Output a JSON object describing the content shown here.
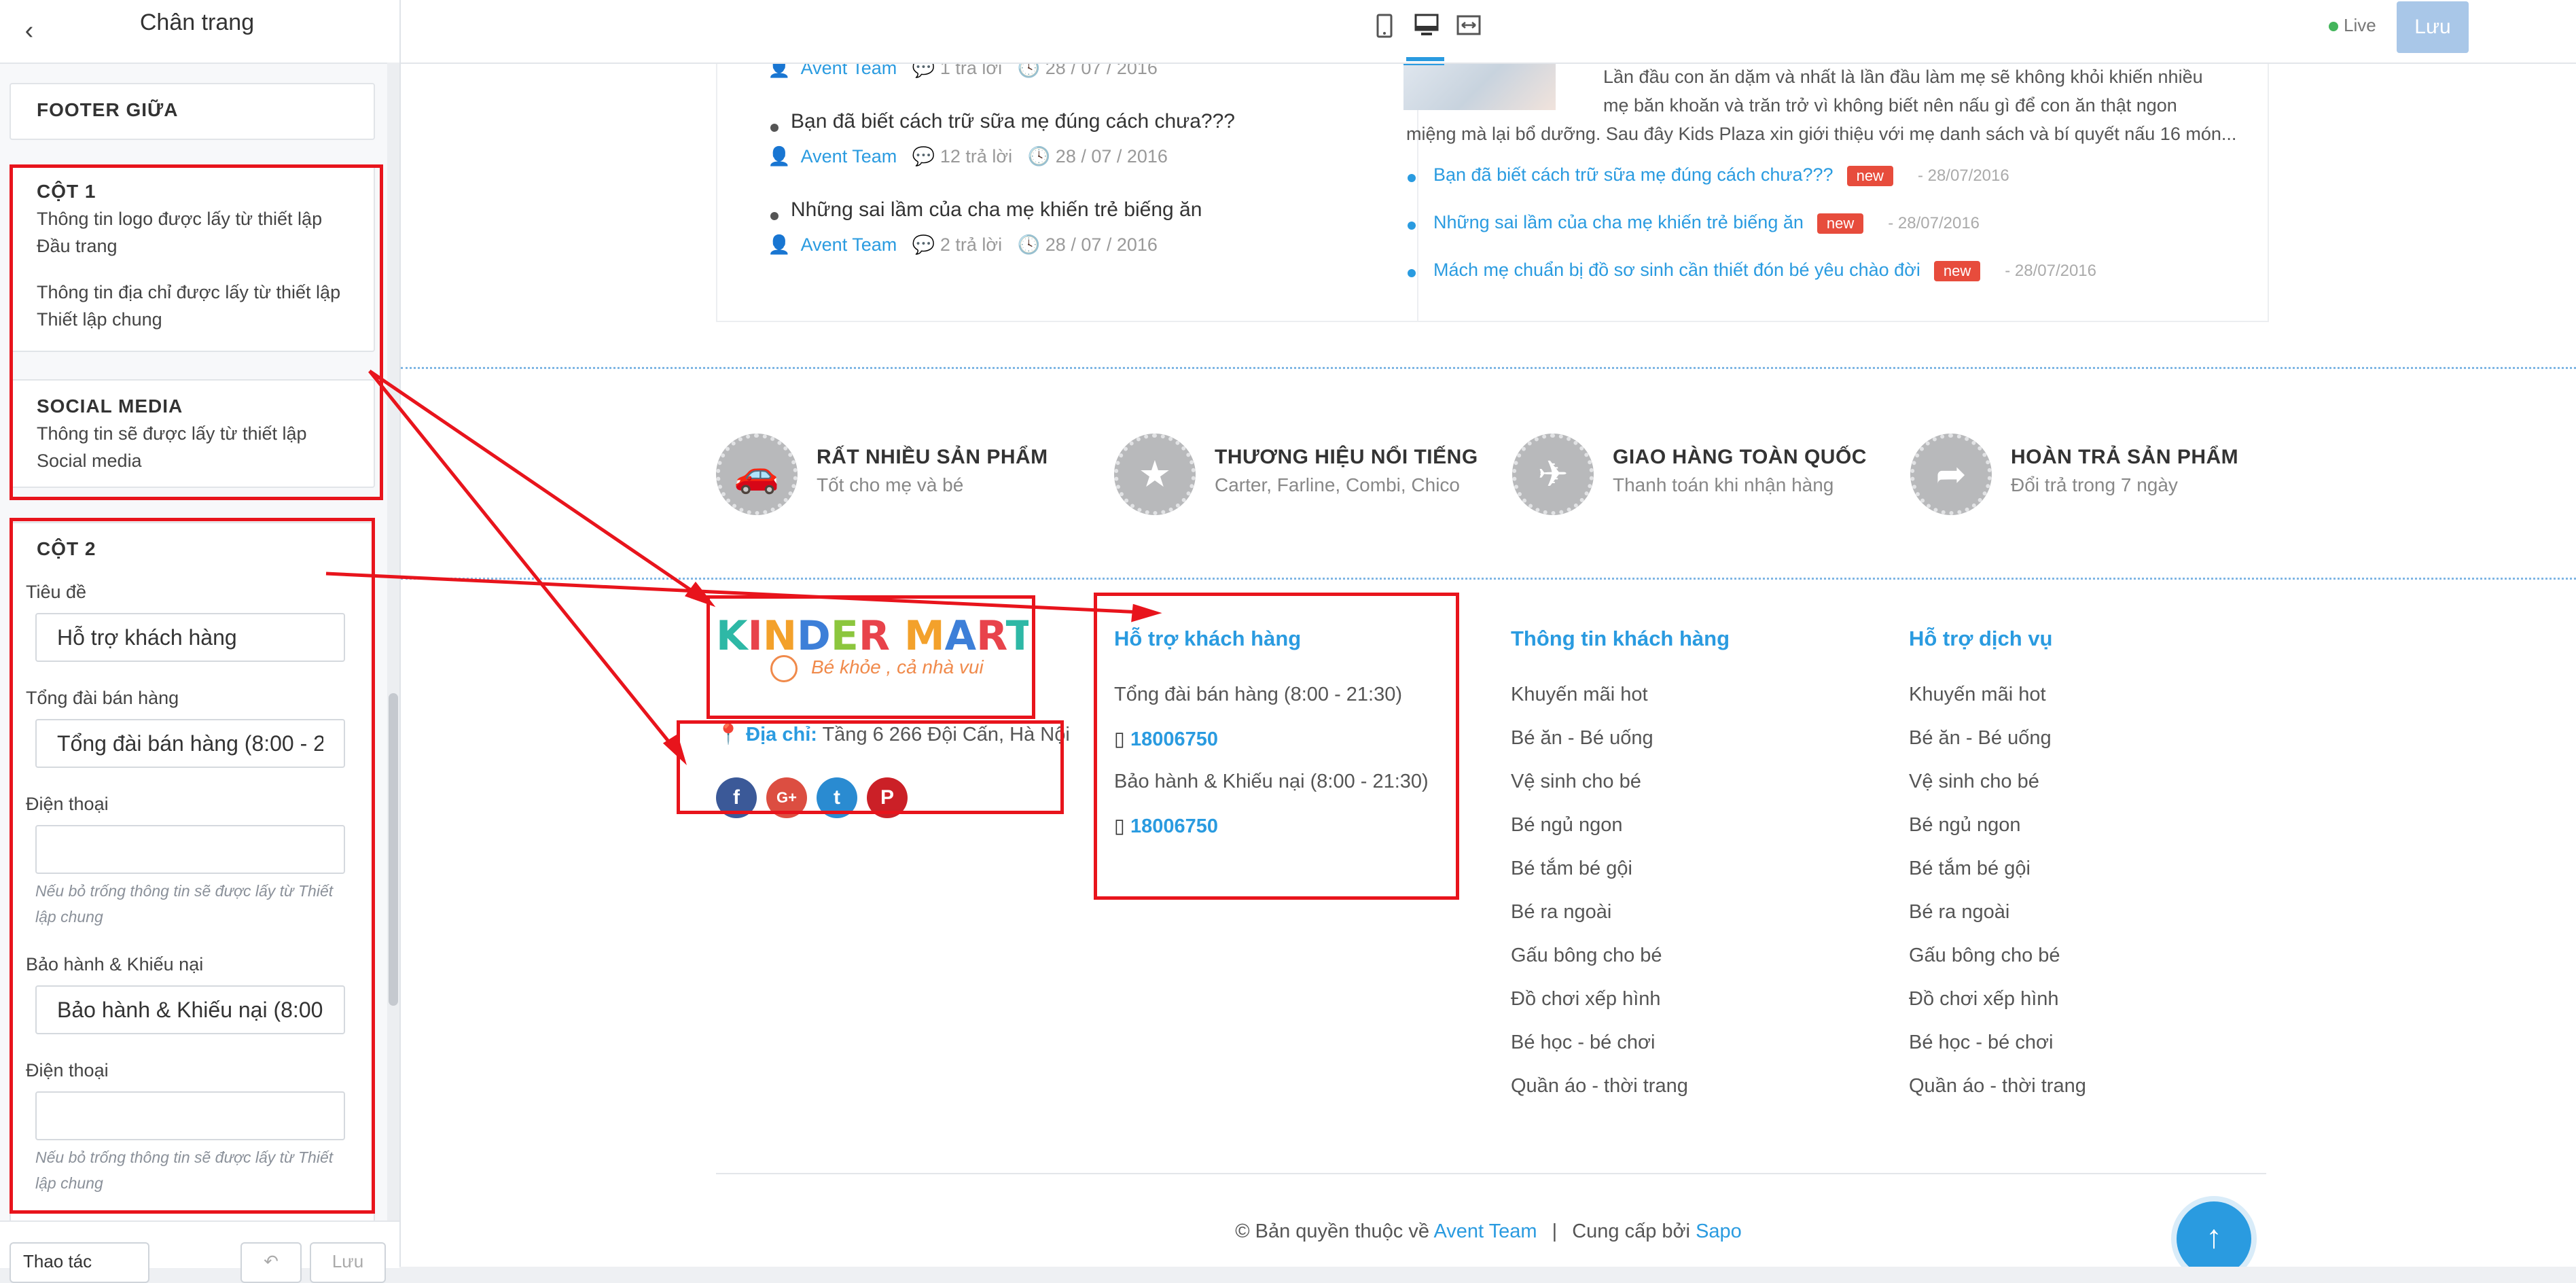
{
  "sidebar": {
    "title": "Chân trang",
    "section_middle": "FOOTER GIỮA",
    "col1": {
      "title": "CỘT 1",
      "text1": "Thông tin logo được lấy từ thiết lập Đầu trang",
      "text2": "Thông tin địa chỉ được lấy từ thiết lập Thiết lập chung"
    },
    "social": {
      "title": "SOCIAL MEDIA",
      "text": "Thông tin sẽ được lấy từ thiết lập Social media"
    },
    "col2": {
      "title": "CỘT 2",
      "heading_label": "Tiêu đề",
      "heading_value": "Hỗ trợ khách hàng",
      "sales_label": "Tổng đài bán hàng",
      "sales_value": "Tổng đài bán hàng (8:00 - 2",
      "phone_label": "Điện thoại",
      "phone_hint": "Nếu bỏ trống thông tin sẽ được lấy từ Thiết lập chung",
      "warranty_label": "Bảo hành & Khiếu nại",
      "warranty_value": "Bảo hành & Khiếu nại (8:00",
      "phone2_label": "Điện thoại",
      "phone2_hint": "Nếu bỏ trống thông tin sẽ được lấy từ Thiết lập chung"
    },
    "footer": {
      "actions": "Thao tác",
      "undo": "↶",
      "save": "Lưu"
    }
  },
  "topbar": {
    "devices": [
      "mobile-icon",
      "desktop-icon",
      "fullwidth-icon"
    ],
    "live": "Live",
    "save": "Lưu"
  },
  "blog": {
    "posts": [
      {
        "title": "",
        "author": "Avent Team",
        "replies": "1 trả lời",
        "date": "28 / 07 / 2016"
      },
      {
        "title": "Bạn đã biết cách trữ sữa mẹ đúng cách chưa???",
        "author": "Avent Team",
        "replies": "12 trả lời",
        "date": "28 / 07 / 2016"
      },
      {
        "title": "Những sai lầm của cha mẹ khiến trẻ biếng ăn",
        "author": "Avent Team",
        "replies": "2 trả lời",
        "date": "28 / 07 / 2016"
      }
    ],
    "excerpt": [
      "Lần đầu con ăn dặm và nhất là lần đầu làm mẹ sẽ không khỏi khiến nhiều",
      "mẹ băn khoăn và trăn trở vì không biết nên nấu gì để con ăn thật ngon",
      "miệng mà lại bổ dưỡng. Sau đây Kids Plaza xin giới thiệu với mẹ danh sách và bí quyết nấu 16 món..."
    ],
    "news": [
      {
        "title": "Bạn đã biết cách trữ sữa mẹ đúng cách chưa???",
        "badge": "new",
        "date": "- 28/07/2016"
      },
      {
        "title": "Những sai lầm của cha mẹ khiến trẻ biếng ăn",
        "badge": "new",
        "date": "- 28/07/2016"
      },
      {
        "title": "Mách mẹ chuẩn bị đồ sơ sinh cần thiết đón bé yêu chào đời",
        "badge": "new",
        "date": "- 28/07/2016"
      }
    ]
  },
  "features": [
    {
      "icon": "car-icon",
      "title": "RẤT NHIỀU SẢN PHẨM",
      "sub": "Tốt cho mẹ và bé"
    },
    {
      "icon": "star-icon",
      "title": "THƯƠNG HIỆU NỔI TIẾNG",
      "sub": "Carter, Farline, Combi, Chico"
    },
    {
      "icon": "plane-icon",
      "title": "GIAO HÀNG TOÀN QUỐC",
      "sub": "Thanh toán khi nhận hàng"
    },
    {
      "icon": "share-icon",
      "title": "HOÀN TRẢ SẢN PHẨM",
      "sub": "Đổi trả trong 7 ngày"
    }
  ],
  "footer": {
    "logo": {
      "name": "KINDER MART",
      "tagline": "Bé khỏe , cả nhà vui"
    },
    "address_label": "Địa chỉ:",
    "address": "Tầng 6 266 Đội Cấn, Hà Nội",
    "socials": [
      "f",
      "G+",
      "t",
      "P"
    ],
    "support": {
      "heading": "Hỗ trợ khách hàng",
      "sales": "Tổng đài bán hàng (8:00 - 21:30)",
      "sales_phone": "18006750",
      "warranty": "Bảo hành & Khiếu nại (8:00 - 21:30)",
      "warranty_phone": "18006750"
    },
    "customer_info": {
      "heading": "Thông tin khách hàng",
      "links": [
        "Khuyến mãi hot",
        "Bé ăn - Bé uống",
        "Vệ sinh cho bé",
        "Bé ngủ ngon",
        "Bé tắm bé gội",
        "Bé ra ngoài",
        "Gấu bông cho bé",
        "Đồ chơi xếp hình",
        "Bé học - bé chơi",
        "Quần áo - thời trang"
      ]
    },
    "service": {
      "heading": "Hỗ trợ dịch vụ",
      "links": [
        "Khuyến mãi hot",
        "Bé ăn - Bé uống",
        "Vệ sinh cho bé",
        "Bé ngủ ngon",
        "Bé tắm bé gội",
        "Bé ra ngoài",
        "Gấu bông cho bé",
        "Đồ chơi xếp hình",
        "Bé học - bé chơi",
        "Quần áo - thời trang"
      ]
    },
    "copyright_prefix": "© Bản quyền thuộc về",
    "copyright_owner": "Avent Team",
    "separator": "|",
    "provided_by": "Cung cấp bởi",
    "provider": "Sapo"
  },
  "colors": {
    "accent": "#2a9be0",
    "annotation": "#e8141c",
    "badge": "#e74c3c"
  }
}
